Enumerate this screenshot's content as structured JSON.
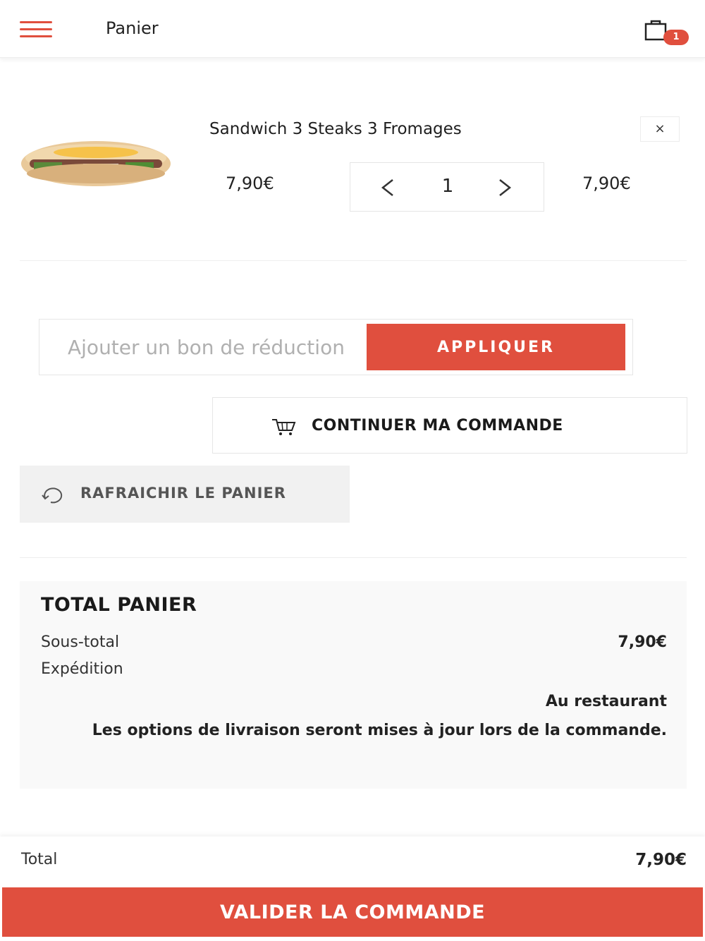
{
  "header": {
    "menu_icon": "hamburger-icon",
    "title": "Panier",
    "cart_icon": "shopping-bag-icon",
    "cart_count": "1"
  },
  "cart_item": {
    "image_icon": "sandwich-image",
    "name": "Sandwich 3 Steaks 3 Fromages",
    "remove_label": "×",
    "unit_price": "7,90€",
    "quantity": "1",
    "decrement_icon": "chevron-left-icon",
    "increment_icon": "chevron-right-icon",
    "line_total": "7,90€"
  },
  "coupon": {
    "placeholder": "Ajouter un bon de réduction",
    "apply_label": "APPLIQUER"
  },
  "actions": {
    "continue_icon": "cart-icon",
    "continue_label": "CONTINUER MA COMMANDE",
    "refresh_icon": "refresh-icon",
    "refresh_label": "RAFRAICHIR LE PANIER"
  },
  "totals": {
    "title": "TOTAL PANIER",
    "subtotal_label": "Sous-total",
    "subtotal_value": "7,90€",
    "shipping_label": "Expédition",
    "shipping_method": "Au restaurant",
    "shipping_note": "Les options de livraison seront mises à jour lors de la commande."
  },
  "footer": {
    "total_label": "Total",
    "total_value": "7,90€",
    "validate_label": "VALIDER LA COMMANDE"
  },
  "colors": {
    "accent": "#e04f3e",
    "panel": "#f9f9f9",
    "secondary_button": "#f1f1f1"
  }
}
